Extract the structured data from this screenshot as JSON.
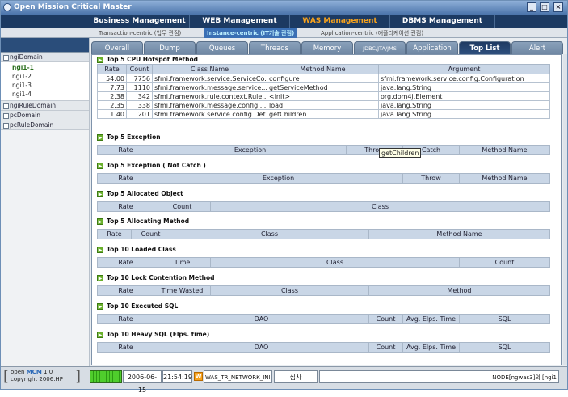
{
  "window": {
    "title": "Open Mission Critical Master"
  },
  "main_nav": [
    {
      "label": "Business Management"
    },
    {
      "label": "WEB Management"
    },
    {
      "label": "WAS Management"
    },
    {
      "label": "DBMS Management"
    }
  ],
  "sub_nav": [
    {
      "label": "Transaction-centric (업무 관점)"
    },
    {
      "label": "Instance-centric (IT기술 관점)"
    },
    {
      "label": "Application-centric (애플리케이션 관점)"
    }
  ],
  "tree": {
    "domain": "ngiDomain",
    "items": [
      "ngi1-1",
      "ngi1-2",
      "ngi1-3",
      "ngi1-4"
    ],
    "others": [
      "ngiRuleDomain",
      "pcDomain",
      "pcRuleDomain"
    ]
  },
  "tabs": [
    {
      "label": "Overall"
    },
    {
      "label": "Dump"
    },
    {
      "label": "Queues"
    },
    {
      "label": "Threads"
    },
    {
      "label": "Memory"
    },
    {
      "label": "JDBC/JTA/JMS"
    },
    {
      "label": "Application"
    },
    {
      "label": "Top List"
    },
    {
      "label": "Alert"
    }
  ],
  "sections": {
    "cpu": {
      "title": "Top 5 CPU Hotspot Method",
      "headers": [
        "Rate",
        "Count",
        "Class Name",
        "Method Name",
        "Argument"
      ],
      "rows": [
        [
          "54.00",
          "7756",
          "sfmi.framework.service.ServiceCo...",
          "configure",
          "sfmi.framework.service.config.Configuration"
        ],
        [
          "7.73",
          "1110",
          "sfmi.framework.message.service....",
          "getServiceMethod",
          "java.lang.String"
        ],
        [
          "2.38",
          "342",
          "sfmi.framework.rule.context.Rule...",
          "<init>",
          "org.dom4j.Element"
        ],
        [
          "2.35",
          "338",
          "sfmi.framework.message.config....",
          "load",
          "java.lang.String"
        ],
        [
          "1.40",
          "201",
          "sfmi.framework.service.config.Def...",
          "getChildren",
          "java.lang.String"
        ]
      ]
    },
    "exception": {
      "title": "Top 5 Exception",
      "headers": [
        "Rate",
        "Exception",
        "Throw",
        "Catch",
        "Method Name"
      ]
    },
    "exception_nc": {
      "title": "Top 5 Exception ( Not Catch )",
      "headers": [
        "Rate",
        "Exception",
        "Throw",
        "Method Name"
      ]
    },
    "alloc_obj": {
      "title": "Top 5 Allocated Object",
      "headers": [
        "Rate",
        "Count",
        "Class"
      ]
    },
    "alloc_method": {
      "title": "Top 5 Allocating Method",
      "headers": [
        "Rate",
        "Count",
        "Class",
        "Method Name"
      ]
    },
    "loaded_class": {
      "title": "Top 10 Loaded Class",
      "headers": [
        "Rate",
        "Time",
        "Class",
        "Count"
      ]
    },
    "lock": {
      "title": "Top 10 Lock Contention Method",
      "headers": [
        "Rate",
        "Time Wasted",
        "Class",
        "Method"
      ]
    },
    "exec_sql": {
      "title": "Top 10 Executed SQL",
      "headers": [
        "Rate",
        "DAO",
        "Count",
        "Avg. Elps. Time",
        "SQL"
      ]
    },
    "heavy_sql": {
      "title": "Top 10 Heavy SQL (Elps. time)",
      "headers": [
        "Rate",
        "DAO",
        "Count",
        "Avg. Elps. Time",
        "SQL"
      ]
    }
  },
  "tooltip": "getChildren",
  "status": {
    "logo_line1_prefix": "open",
    "logo_brand": "MCM",
    "logo_version": "1.0",
    "logo_line2": "copyright 2006.HP",
    "date": "2006-06-15",
    "time": "21:54:19",
    "w_icon": "W",
    "network": "WAS_TR_NETWORK_INI",
    "user": "심사",
    "node": "NODE[ngwas3]의 [ngi1"
  },
  "colors": {
    "active_nav": "#f7a21c",
    "nav_bg": "#1c3a62",
    "active_tab": "#1e3a62"
  }
}
